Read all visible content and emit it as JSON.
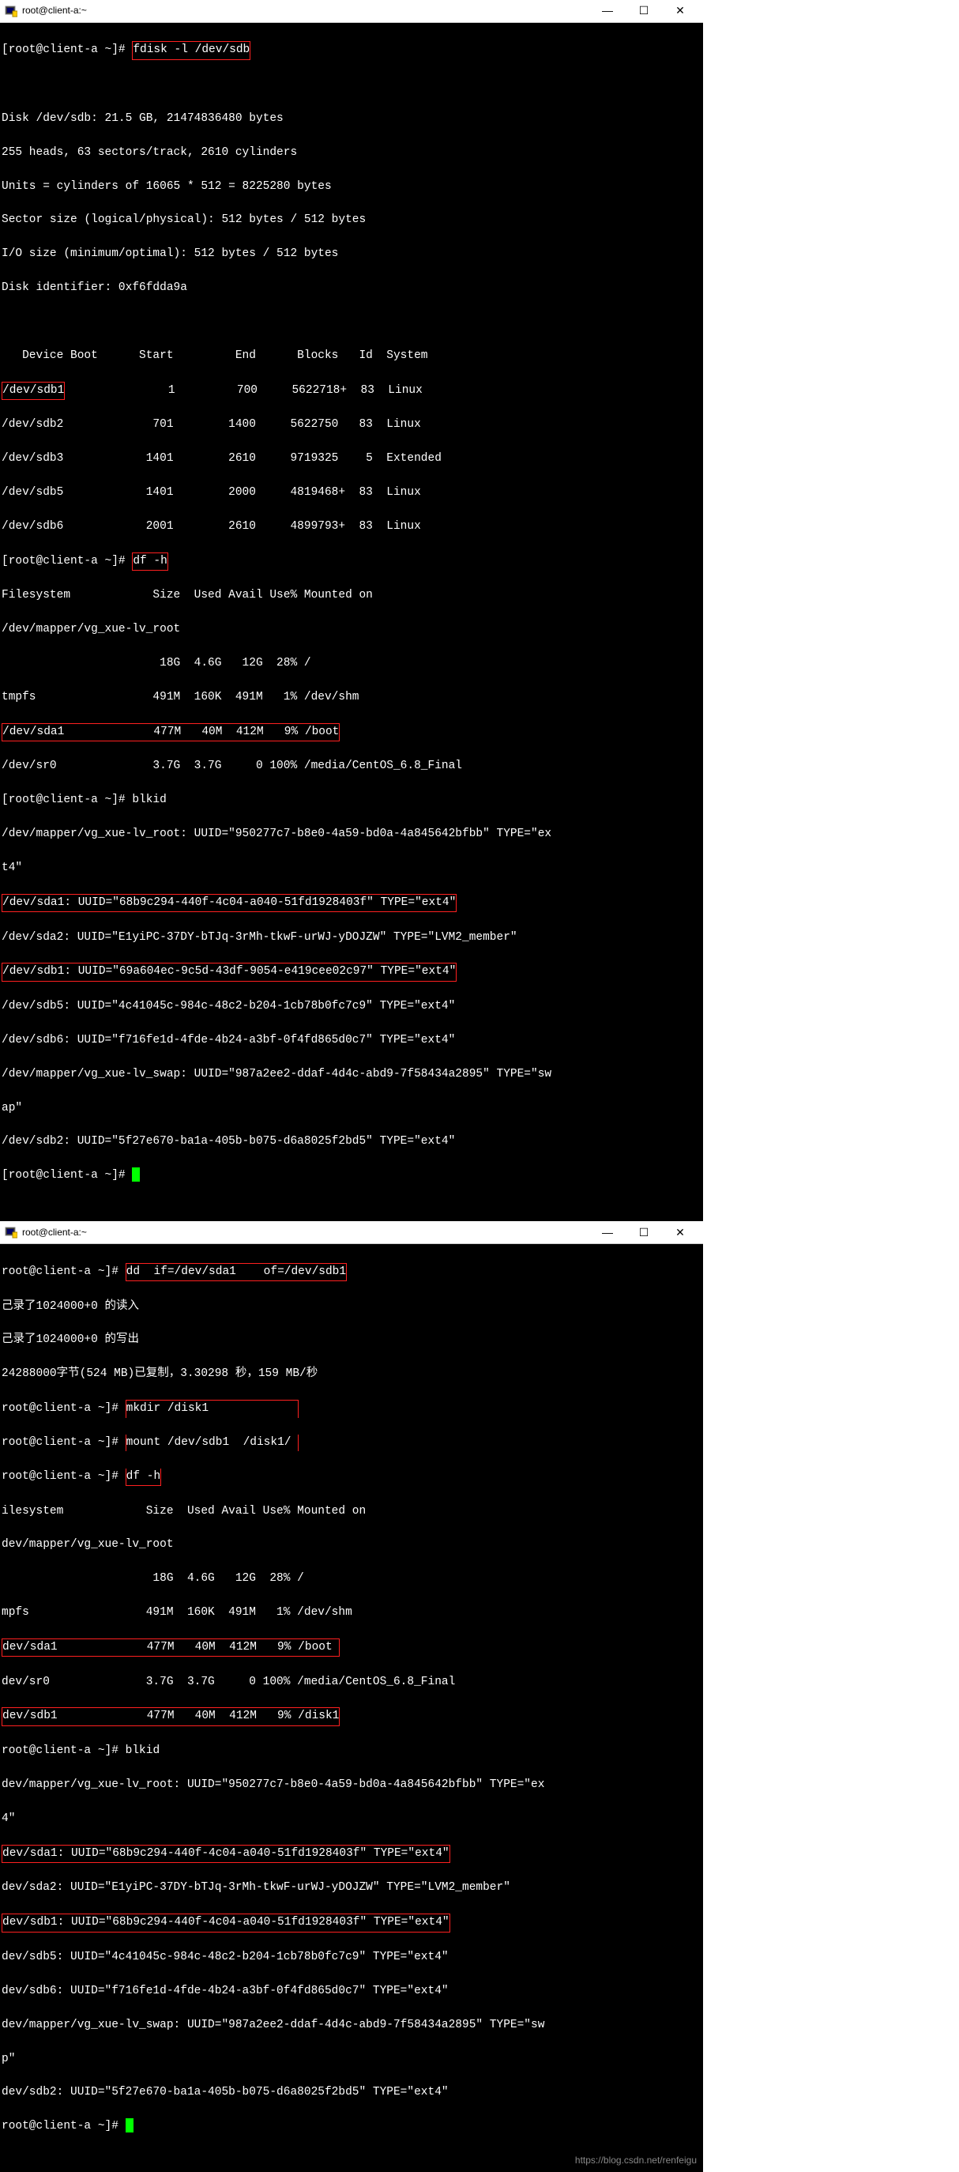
{
  "window1": {
    "title": "root@client-a:~",
    "prompt": "[root@client-a ~]# ",
    "cmd_fdisk": "fdisk -l /dev/sdb",
    "disk_line": "Disk /dev/sdb: 21.5 GB, 21474836480 bytes",
    "heads_line": "255 heads, 63 sectors/track, 2610 cylinders",
    "units_line": "Units = cylinders of 16065 * 512 = 8225280 bytes",
    "sector_line": "Sector size (logical/physical): 512 bytes / 512 bytes",
    "io_line": "I/O size (minimum/optimal): 512 bytes / 512 bytes",
    "ident_line": "Disk identifier: 0xf6fdda9a",
    "part_header": "   Device Boot      Start         End      Blocks   Id  System",
    "sdb1": "/dev/sdb1",
    "sdb1_rest": "               1         700     5622718+  83  Linux",
    "sdb2": "/dev/sdb2             701        1400     5622750   83  Linux",
    "sdb3": "/dev/sdb3            1401        2610     9719325    5  Extended",
    "sdb5": "/dev/sdb5            1401        2000     4819468+  83  Linux",
    "sdb6": "/dev/sdb6            2001        2610     4899793+  83  Linux",
    "cmd_dfh": "df -h",
    "df_header": "Filesystem            Size  Used Avail Use% Mounted on",
    "df_vg": "/dev/mapper/vg_xue-lv_root",
    "df_vg2": "                       18G  4.6G   12G  28% /",
    "df_tmpfs": "tmpfs                 491M  160K  491M   1% /dev/shm",
    "df_sda1": "/dev/sda1             477M   40M  412M   9% /boot",
    "df_sr0": "/dev/sr0              3.7G  3.7G     0 100% /media/CentOS_6.8_Final",
    "cmd_blkid": "blkid",
    "blk_vg1": "/dev/mapper/vg_xue-lv_root: UUID=\"950277c7-b8e0-4a59-bd0a-4a845642bfbb\" TYPE=\"ex",
    "blk_vg2": "t4\"",
    "blk_sda1": "/dev/sda1: UUID=\"68b9c294-440f-4c04-a040-51fd1928403f\" TYPE=\"ext4\"",
    "blk_sda2": "/dev/sda2: UUID=\"E1yiPC-37DY-bTJq-3rMh-tkwF-urWJ-yDOJZW\" TYPE=\"LVM2_member\"",
    "blk_sdb1": "/dev/sdb1: UUID=\"69a604ec-9c5d-43df-9054-e419cee02c97\" TYPE=\"ext4\"",
    "blk_sdb5": "/dev/sdb5: UUID=\"4c41045c-984c-48c2-b204-1cb78b0fc7c9\" TYPE=\"ext4\"",
    "blk_sdb6": "/dev/sdb6: UUID=\"f716fe1d-4fde-4b24-a3bf-0f4fd865d0c7\" TYPE=\"ext4\"",
    "blk_swap1": "/dev/mapper/vg_xue-lv_swap: UUID=\"987a2ee2-ddaf-4d4c-abd9-7f58434a2895\" TYPE=\"sw",
    "blk_swap2": "ap\"",
    "blk_sdb2": "/dev/sdb2: UUID=\"5f27e670-ba1a-405b-b075-d6a8025f2bd5\" TYPE=\"ext4\""
  },
  "window2": {
    "title": "root@client-a:~",
    "prompt_short": "root@client-a ~]# ",
    "cmd_dd": "dd  if=/dev/sda1    of=/dev/sdb1",
    "dd_in": "己录了1024000+0 的读入",
    "dd_out": "己录了1024000+0 的写出",
    "dd_bytes": "24288000字节(524 MB)已复制，3.30298 秒，159 MB/秒",
    "cmd_mkdir": "mkdir /disk1             ",
    "cmd_mount": "mount /dev/sdb1  /disk1/ ",
    "cmd_dfh": "df -h",
    "df_header": "ilesystem            Size  Used Avail Use% Mounted on",
    "df_vg": "dev/mapper/vg_xue-lv_root",
    "df_vg2": "                      18G  4.6G   12G  28% /",
    "df_tmpfs": "mpfs                 491M  160K  491M   1% /dev/shm",
    "df_sda1": "dev/sda1             477M   40M  412M   9% /boot ",
    "df_sr0": "dev/sr0              3.7G  3.7G     0 100% /media/CentOS_6.8_Final",
    "df_sdb1": "dev/sdb1             477M   40M  412M   9% /disk1",
    "cmd_blkid": "blkid",
    "blk_vg1": "dev/mapper/vg_xue-lv_root: UUID=\"950277c7-b8e0-4a59-bd0a-4a845642bfbb\" TYPE=\"ex",
    "blk_vg2": "4\"",
    "blk_sda1": "dev/sda1: UUID=\"68b9c294-440f-4c04-a040-51fd1928403f\" TYPE=\"ext4\"",
    "blk_sda2": "dev/sda2: UUID=\"E1yiPC-37DY-bTJq-3rMh-tkwF-urWJ-yDOJZW\" TYPE=\"LVM2_member\"",
    "blk_sdb1": "dev/sdb1: UUID=\"68b9c294-440f-4c04-a040-51fd1928403f\" TYPE=\"ext4\"",
    "blk_sdb5": "dev/sdb5: UUID=\"4c41045c-984c-48c2-b204-1cb78b0fc7c9\" TYPE=\"ext4\"",
    "blk_sdb6": "dev/sdb6: UUID=\"f716fe1d-4fde-4b24-a3bf-0f4fd865d0c7\" TYPE=\"ext4\"",
    "blk_swap1": "dev/mapper/vg_xue-lv_swap: UUID=\"987a2ee2-ddaf-4d4c-abd9-7f58434a2895\" TYPE=\"sw",
    "blk_swap2": "p\"",
    "blk_sdb2": "dev/sdb2: UUID=\"5f27e670-ba1a-405b-b075-d6a8025f2bd5\" TYPE=\"ext4\""
  },
  "watermark": "https://blog.csdn.net/renfeigu"
}
